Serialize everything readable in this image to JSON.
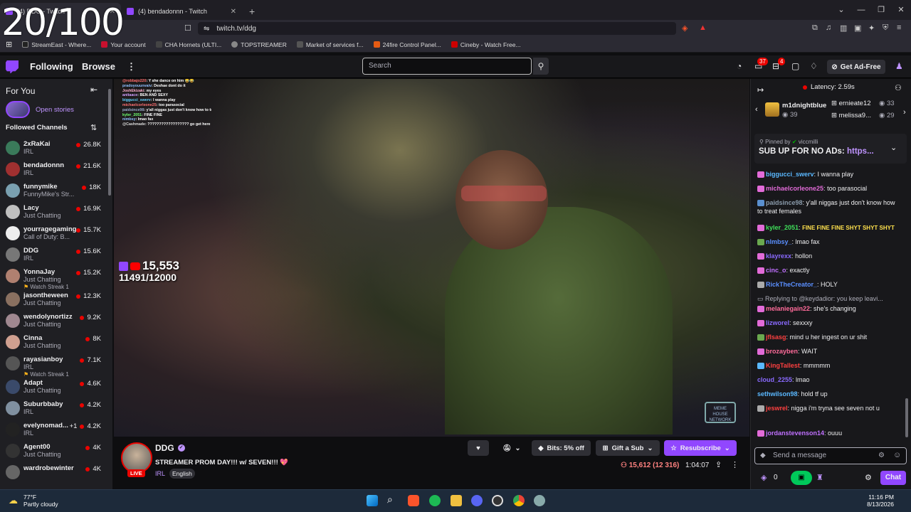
{
  "overlay_counter": "20/100",
  "browser": {
    "tabs": [
      {
        "title": "(4) DDG - Twitch",
        "active": true
      },
      {
        "title": "(4) bendadonnn - Twitch",
        "active": false
      }
    ],
    "url": "twitch.tv/ddg",
    "bookmarks": [
      {
        "label": "StreamEast - Where...",
        "color": "#111"
      },
      {
        "label": "Your account",
        "color": "#c8102e"
      },
      {
        "label": "CHA Hornets (ULTI...",
        "color": "#444"
      },
      {
        "label": "TOPSTREAMER",
        "color": "#666"
      },
      {
        "label": "Market of services f...",
        "color": "#555"
      },
      {
        "label": "24fire Control Panel...",
        "color": "#e55b13"
      },
      {
        "label": "Cineby - Watch Free...",
        "color": "#cc0000"
      }
    ]
  },
  "twitch_nav": {
    "following": "Following",
    "browse": "Browse",
    "search_placeholder": "Search",
    "notif_count_1": "37",
    "notif_count_2": "4",
    "ad_free": "Get Ad-Free"
  },
  "sidebar": {
    "for_you": "For You",
    "open_stories": "Open stories",
    "followed_channels": "Followed Channels",
    "channels": [
      {
        "name": "2xRaKai",
        "game": "IRL",
        "viewers": "26.8K",
        "color": "#3a7a5a"
      },
      {
        "name": "bendadonnn",
        "game": "IRL",
        "viewers": "21.6K",
        "color": "#a03030"
      },
      {
        "name": "funnymike",
        "game": "FunnyMike's Str...",
        "viewers": "18K",
        "color": "#7aa0b0"
      },
      {
        "name": "Lacy",
        "game": "Just Chatting",
        "viewers": "16.9K",
        "color": "#c0c0c0"
      },
      {
        "name": "yourragegaming",
        "game": "Call of Duty: B...",
        "viewers": "15.7K",
        "color": "#eeeeee"
      },
      {
        "name": "DDG",
        "game": "IRL",
        "viewers": "15.6K",
        "color": "#777777"
      },
      {
        "name": "YonnaJay",
        "game": "Just Chatting",
        "viewers": "15.2K",
        "sub": "Watch Streak 1",
        "color": "#b08070"
      },
      {
        "name": "jasontheween",
        "game": "Just Chatting",
        "viewers": "12.3K",
        "color": "#8a7060"
      },
      {
        "name": "wendolynortizz",
        "game": "Just Chatting",
        "viewers": "9.2K",
        "color": "#a08890"
      },
      {
        "name": "Cinna",
        "game": "Just Chatting",
        "viewers": "8K",
        "color": "#d0a090"
      },
      {
        "name": "rayasianboy",
        "game": "IRL",
        "viewers": "7.1K",
        "sub": "Watch Streak 1",
        "color": "#555"
      },
      {
        "name": "Adapt",
        "game": "Just Chatting",
        "viewers": "4.6K",
        "color": "#3a4a6a"
      },
      {
        "name": "Suburbbaby",
        "game": "IRL",
        "viewers": "4.2K",
        "color": "#8090a0"
      },
      {
        "name": "evelynomad...",
        "extra": "+1",
        "game": "IRL",
        "viewers": "4.2K",
        "color": "#222"
      },
      {
        "name": "Agent00",
        "game": "Just Chatting",
        "viewers": "4K",
        "color": "#333"
      },
      {
        "name": "wardrobewinter",
        "game": "",
        "viewers": "4K",
        "color": "#666"
      }
    ]
  },
  "video_overlay": {
    "viewer_count": "15,553",
    "sub_goal": "11491/12000",
    "chat_lines": [
      {
        "user": "@robbajo220",
        "text": "Y she dance on him 😂😂",
        "color": "#ff6b6b"
      },
      {
        "user": "pradoyouunvaiv",
        "text": "Deshae dont do it",
        "color": "#8fbfff"
      },
      {
        "user": "JoshEkizaki",
        "text": "my eyes",
        "color": "#ffb0d0"
      },
      {
        "user": "anitaace",
        "text": "BEN AND SEXY",
        "color": "#d0a0ff"
      },
      {
        "user": "biggucci_swerv",
        "text": "I wanna play",
        "color": "#60d0ff"
      },
      {
        "user": "michaelcorleone25",
        "text": "too parasocial",
        "color": "#ff7070"
      },
      {
        "user": "paidsince98",
        "text": "y'all niggas just don't know how to treat females",
        "color": "#9ac"
      },
      {
        "user": "kyler_2051",
        "text": "FINE FINE",
        "color": "#70ff70"
      },
      {
        "user": "nimbsy",
        "text": "lmao fax",
        "color": "#8fbfff"
      },
      {
        "user": "@Cashmade",
        "text": "?????????????????? go get here",
        "color": "#ddd"
      }
    ],
    "network_logo": "MEME HOUSE NETWORK"
  },
  "stream_info": {
    "channel": "DDG",
    "title": "STREAMER PROM DAY!!! w/ SEVEN!!! 💖",
    "category": "IRL",
    "tag": "English",
    "live_label": "LIVE",
    "bits_label": "Bits: 5% off",
    "gift_label": "Gift a Sub",
    "resub_label": "Resubscribe",
    "viewers": "15,612 (12 316)",
    "uptime": "1:04:07"
  },
  "chat": {
    "latency": "Latency: 2.59s",
    "leaderboard": [
      {
        "name": "m1dnightblue",
        "count": "39"
      },
      {
        "name": "ernieate12",
        "count": "33"
      },
      {
        "name": "melissa9...",
        "count": "29"
      }
    ],
    "pinned_by": "Pinned by",
    "pinned_user": "viccmilli",
    "pinned_text": "SUB UP FOR NO ADs:",
    "pinned_link": "https...",
    "messages": [
      {
        "user": "biggucci_swerv",
        "color": "#5ab8ff",
        "text": "I wanna play",
        "badge": "#e26bd8"
      },
      {
        "user": "michaelcorleone25",
        "color": "#e26bd8",
        "text": "too parasocial",
        "badge": "#e26bd8"
      },
      {
        "user": "paidsince98",
        "color": "#8a9aaa",
        "text": "y'all niggas just don't know how to treat females",
        "badge": "#5a8fcf"
      },
      {
        "user": "kyler_2051",
        "color": "#3fe05a",
        "text": "FINE FINE FINE SHYT SHYT SHYT",
        "badge": "#e26bd8",
        "emote": true
      },
      {
        "user": "nlmbsy_",
        "color": "#5a8fff",
        "text": "lmao fax",
        "badge": "#6aa84f"
      },
      {
        "user": "klayrexx",
        "color": "#8a6aff",
        "text": "hollon",
        "badge": "#e26bd8"
      },
      {
        "user": "cinc_o",
        "color": "#c070ff",
        "text": "exactly",
        "badge": "#e26bd8"
      },
      {
        "user": "RickTheCreator_",
        "color": "#5a8fff",
        "text": "HOLY",
        "badge": "#aaa"
      },
      {
        "reply": "Replying to @keydadior: you keep leavi..."
      },
      {
        "user": "melaniegain22",
        "color": "#ff6b9a",
        "text": "she's changing",
        "badge": "#e26bd8"
      },
      {
        "user": "lizworel",
        "color": "#8a6aff",
        "text": "sexxxy",
        "badge": "#e26bd8"
      },
      {
        "user": "jflsasg",
        "color": "#ff4040",
        "text": "mind u her ingest on ur shit",
        "badge": "#6aa84f"
      },
      {
        "user": "brozayben",
        "color": "#ff6b9a",
        "text": "WAIT",
        "badge": "#e26bd8"
      },
      {
        "user": "KingTallest",
        "color": "#ff4040",
        "text": "mmmmm",
        "badge": "#5ab8ff"
      },
      {
        "user": "cloud_2255",
        "color": "#8a6aff",
        "text": "lmao"
      },
      {
        "user": "sethwilson98",
        "color": "#5ab8ff",
        "text": "hold tf up"
      },
      {
        "user": "jeswrel",
        "color": "#ff4040",
        "text": "nigga i'm tryna see seven not u",
        "badge": "#aaa"
      },
      {
        "user": "jordanstevenson14",
        "color": "#c070ff",
        "text": "ouuu",
        "badge": "#e26bd8"
      }
    ],
    "send_placeholder": "Send a message",
    "points": "0",
    "chat_button": "Chat"
  },
  "taskbar": {
    "temp": "77°F",
    "weather": "Partly cloudy",
    "time": "11:16 PM",
    "date": "8/13/2026"
  }
}
